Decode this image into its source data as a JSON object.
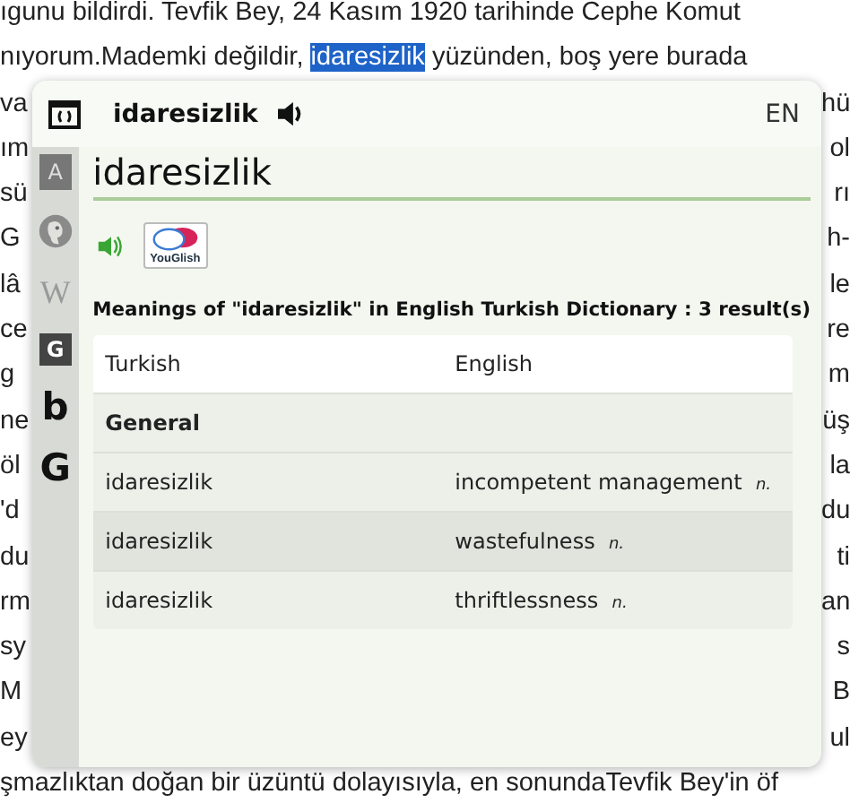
{
  "document": {
    "top_lines": [
      "ıgunu bildirdi. Tevfik Bey, 24 Kasım 1920 tarihinde Cephe Komut",
      "nıyorum.Mademki değildir, "
    ],
    "highlighted_word": "idaresizlik",
    "line_2_rest": " yüzünden, boş yere burada",
    "covered_lines": [
      {
        "left": "va",
        "right": "hü"
      },
      {
        "left": "ım",
        "right": "ol"
      },
      {
        "left": "sü",
        "right": "rı"
      },
      {
        "left": "G",
        "right": "h-"
      },
      {
        "left": "lâ",
        "right": "le"
      },
      {
        "left": "ce",
        "right": "re"
      },
      {
        "left": "g",
        "right": "m"
      },
      {
        "left": "ne",
        "right": "üş"
      },
      {
        "left": "öl",
        "right": "la"
      },
      {
        "left": "'d",
        "right": "du"
      },
      {
        "left": "du",
        "right": "ti"
      },
      {
        "left": "rm",
        "right": "an"
      },
      {
        "left": "sy",
        "right": "s"
      },
      {
        "left": "M",
        "right": "B"
      },
      {
        "left": "ey",
        "right": "ul"
      }
    ],
    "bottom_line": "şmazlıktan doğan bir üzüntü dolayısıyla, en sonundaTevfik Bey'in öf"
  },
  "popup": {
    "header_word": "idaresizlik",
    "language": "EN",
    "sidebar": [
      {
        "kind": "tile",
        "glyph": "A"
      },
      {
        "kind": "duck"
      },
      {
        "kind": "serif",
        "glyph": "W"
      },
      {
        "kind": "dark-tile",
        "glyph": "G"
      },
      {
        "kind": "bold",
        "glyph": "b"
      },
      {
        "kind": "bold",
        "glyph": "G"
      }
    ],
    "search": {
      "value": "idaresizlik"
    },
    "youglish_label": "YouGlish",
    "meanings_title": "Meanings of \"idaresizlik\" in English Turkish Dictionary : 3 result(s)",
    "table": {
      "columns": [
        "Turkish",
        "English"
      ],
      "group": "General",
      "rows": [
        {
          "turkish": "idaresizlik",
          "english": "incompetent management",
          "pos": "n."
        },
        {
          "turkish": "idaresizlik",
          "english": "wastefulness",
          "pos": "n."
        },
        {
          "turkish": "idaresizlik",
          "english": "thriftlessness",
          "pos": "n."
        }
      ]
    }
  }
}
